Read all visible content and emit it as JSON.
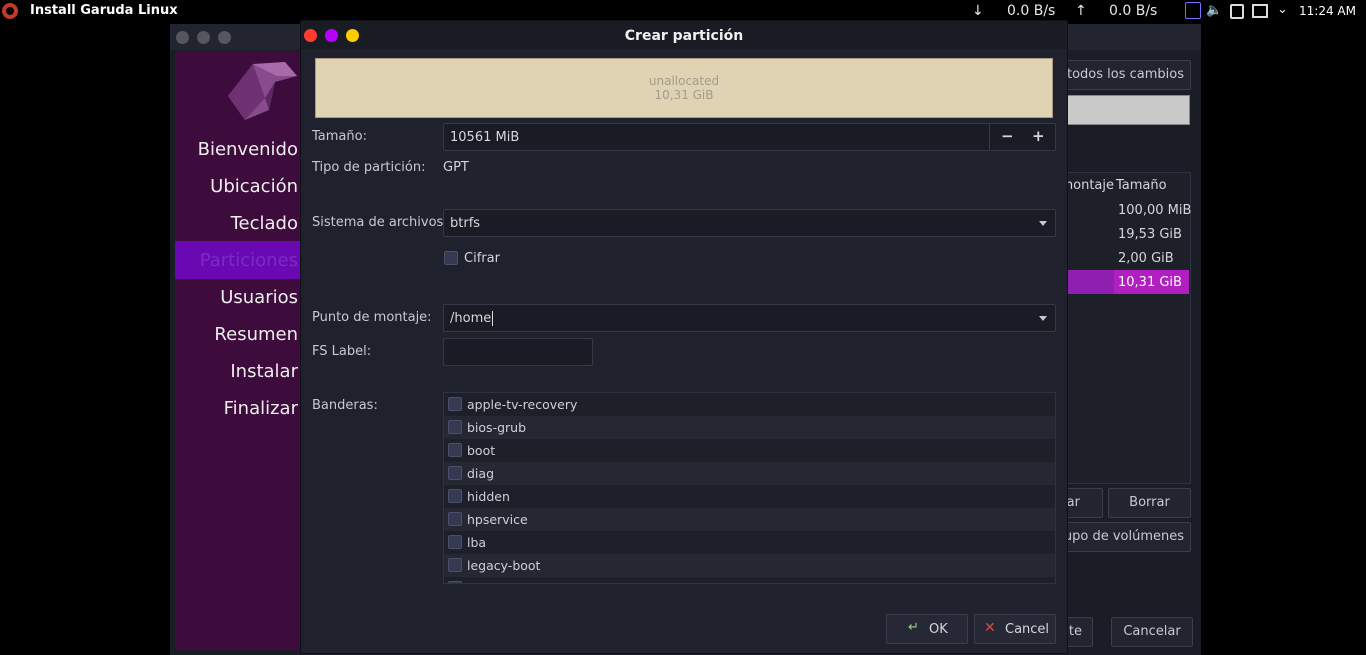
{
  "panel": {
    "app_title": "Install Garuda Linux",
    "down_arrow": "↓",
    "down_speed": "0.0 B/s",
    "up_arrow": "↑",
    "up_speed": "0.0 B/s",
    "clock": "11:24 AM"
  },
  "installer": {
    "sidebar_items": [
      "Bienvenido",
      "Ubicación",
      "Teclado",
      "Particiones",
      "Usuarios",
      "Resumen",
      "Instalar",
      "Finalizar"
    ],
    "revert_button": "Revertir todos los cambios",
    "table_headers": {
      "mount": "Punto de montaje",
      "size": "Tamaño"
    },
    "table_sizes": [
      "100,00 MiB",
      "19,53 GiB",
      "2,00 GiB",
      "10,31 GiB"
    ],
    "edit_button": "Editar",
    "delete_button": "Borrar",
    "volume_group_button": "Nuevo grupo de volúmenes",
    "next_button": "Siguiente",
    "cancel_button": "Cancelar"
  },
  "dialog": {
    "title": "Crear partición",
    "bar_label": "unallocated",
    "bar_size": "10,31 GiB",
    "size_label": "Tamaño:",
    "size_value": "10561 MiB",
    "minus": "−",
    "plus": "+",
    "type_label": "Tipo de partición:",
    "type_value": "GPT",
    "fs_label": "Sistema de archivos:",
    "fs_value": "btrfs",
    "encrypt_label": "Cifrar",
    "mount_label": "Punto de montaje:",
    "mount_value": "/home",
    "fslabel_label": "FS Label:",
    "fslabel_value": "",
    "flags_label": "Banderas:",
    "flags": [
      "apple-tv-recovery",
      "bios-grub",
      "boot",
      "diag",
      "hidden",
      "hpservice",
      "lba",
      "legacy-boot"
    ],
    "ok_button": "OK",
    "cancel_button": "Cancel"
  },
  "colors": {
    "close": "#ff3b30",
    "minimize": "#b900ff",
    "maximize": "#ffcc00",
    "sidebar": "#3d0c3c",
    "sidebar_active": "#6a09b4",
    "selected_row": "#8e1fb0",
    "unallocated": "#e0d3b3"
  }
}
